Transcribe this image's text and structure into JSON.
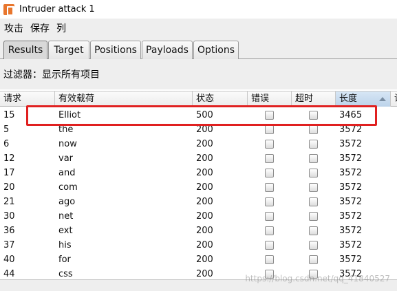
{
  "window": {
    "title": "Intruder attack 1"
  },
  "menu": {
    "items": [
      "攻击",
      "保存",
      "列"
    ]
  },
  "tabs": [
    "Results",
    "Target",
    "Positions",
    "Payloads",
    "Options"
  ],
  "active_tab": "Results",
  "filter": {
    "label": "过滤器：",
    "value": "显示所有项目"
  },
  "table": {
    "columns": [
      "请求",
      "有效载荷",
      "状态",
      "错误",
      "超时",
      "长度",
      "请"
    ],
    "sorted_column": "长度",
    "rows": [
      {
        "request": "15",
        "payload": "Elliot",
        "status": "500",
        "error": false,
        "timeout": false,
        "length": "3465"
      },
      {
        "request": "5",
        "payload": "the",
        "status": "200",
        "error": false,
        "timeout": false,
        "length": "3572"
      },
      {
        "request": "6",
        "payload": "now",
        "status": "200",
        "error": false,
        "timeout": false,
        "length": "3572"
      },
      {
        "request": "12",
        "payload": "var",
        "status": "200",
        "error": false,
        "timeout": false,
        "length": "3572"
      },
      {
        "request": "17",
        "payload": "and",
        "status": "200",
        "error": false,
        "timeout": false,
        "length": "3572"
      },
      {
        "request": "20",
        "payload": "com",
        "status": "200",
        "error": false,
        "timeout": false,
        "length": "3572"
      },
      {
        "request": "21",
        "payload": "ago",
        "status": "200",
        "error": false,
        "timeout": false,
        "length": "3572"
      },
      {
        "request": "30",
        "payload": "net",
        "status": "200",
        "error": false,
        "timeout": false,
        "length": "3572"
      },
      {
        "request": "36",
        "payload": "ext",
        "status": "200",
        "error": false,
        "timeout": false,
        "length": "3572"
      },
      {
        "request": "37",
        "payload": "his",
        "status": "200",
        "error": false,
        "timeout": false,
        "length": "3572"
      },
      {
        "request": "40",
        "payload": "for",
        "status": "200",
        "error": false,
        "timeout": false,
        "length": "3572"
      },
      {
        "request": "44",
        "payload": "css",
        "status": "200",
        "error": false,
        "timeout": false,
        "length": "3572"
      }
    ]
  },
  "watermark": "https://blog.csdn.net/qq_41840527",
  "colors": {
    "highlight": "#e02020",
    "sorted_header": "#bcd3ea"
  }
}
